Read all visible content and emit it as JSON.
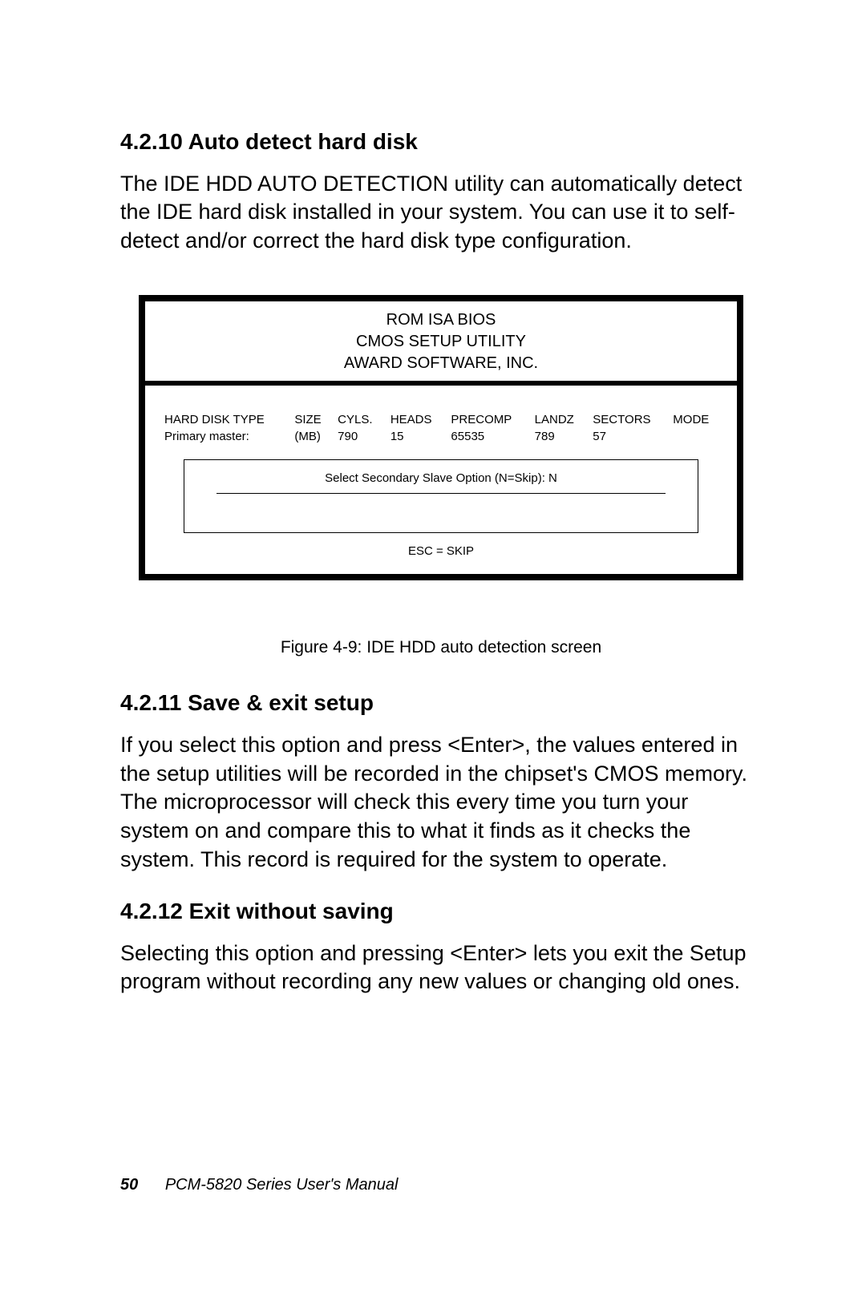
{
  "section1": {
    "heading": "4.2.10 Auto detect hard disk",
    "body": "The IDE HDD AUTO DETECTION utility can automatically detect the IDE hard disk installed in your system. You can use it to self-detect and/or correct the hard disk type configuration."
  },
  "bios": {
    "title1": "ROM ISA BIOS",
    "title2": "CMOS SETUP UTILITY",
    "title3": "AWARD SOFTWARE, INC.",
    "headers": [
      "HARD DISK TYPE",
      "SIZE",
      "CYLS.",
      "HEADS",
      "PRECOMP",
      "LANDZ",
      "SECTORS",
      "MODE"
    ],
    "row": [
      "Primary master:",
      "(MB)",
      "790",
      "15",
      "65535",
      "789",
      "57",
      ""
    ],
    "prompt": "Select Secondary Slave Option (N=Skip): N",
    "esc": "ESC = SKIP"
  },
  "figure_caption": "Figure 4-9: IDE HDD auto detection screen",
  "section2": {
    "heading": "4.2.11 Save & exit setup",
    "body": "If you select this option and press <Enter>, the values entered in the setup utilities will be recorded in the chipset's CMOS memory. The microprocessor will check this every time you turn your system on and compare this to what it finds as it checks the system. This record is required for the system to operate."
  },
  "section3": {
    "heading": "4.2.12 Exit without saving",
    "body": "Selecting this option and pressing <Enter> lets you exit the Setup program without recording any new values or changing old ones."
  },
  "footer": {
    "page_number": "50",
    "manual_title": "PCM-5820 Series  User's Manual"
  },
  "chart_data": {
    "type": "table",
    "title": "IDE HDD auto detection screen",
    "columns": [
      "HARD DISK TYPE",
      "SIZE",
      "CYLS.",
      "HEADS",
      "PRECOMP",
      "LANDZ",
      "SECTORS",
      "MODE"
    ],
    "rows": [
      [
        "Primary master:",
        "(MB)",
        790,
        15,
        65535,
        789,
        57,
        ""
      ]
    ],
    "prompt": "Select Secondary Slave Option (N=Skip): N",
    "footer": "ESC = SKIP"
  }
}
